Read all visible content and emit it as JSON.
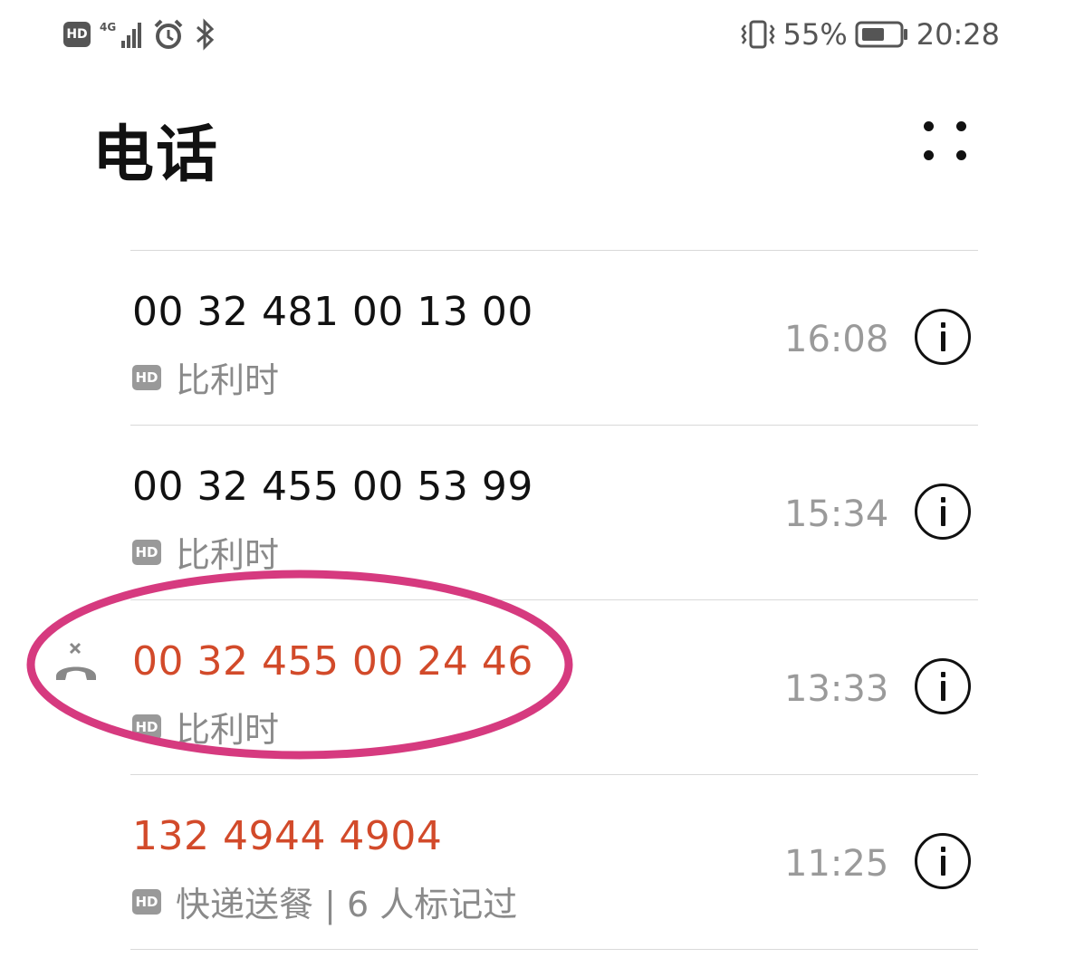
{
  "status_bar": {
    "hd_label": "HD",
    "network_label": "4G",
    "battery_percent": "55%",
    "time": "20:28",
    "icons": [
      "hd-icon",
      "signal-icon",
      "alarm-icon",
      "bluetooth-icon",
      "vibrate-icon",
      "battery-icon"
    ]
  },
  "header": {
    "title": "电话",
    "more_icon": "more-dots-icon"
  },
  "calls": [
    {
      "number": "00 32 481 00 13 00",
      "hd": "HD",
      "location": "比利时",
      "time": "16:08",
      "missed": false
    },
    {
      "number": "00 32 455 00 53 99",
      "hd": "HD",
      "location": "比利时",
      "time": "15:34",
      "missed": false
    },
    {
      "number": "00 32 455 00 24 46",
      "hd": "HD",
      "location": "比利时",
      "time": "13:33",
      "missed": true
    },
    {
      "number": "132 4944 4904",
      "hd": "HD",
      "location": "快递送餐 | 6 人标记过",
      "time": "11:25",
      "missed": true
    }
  ],
  "colors": {
    "missed_call": "#d24a2a",
    "annotation": "#d63a7f",
    "secondary_text": "#8a8a8a"
  }
}
